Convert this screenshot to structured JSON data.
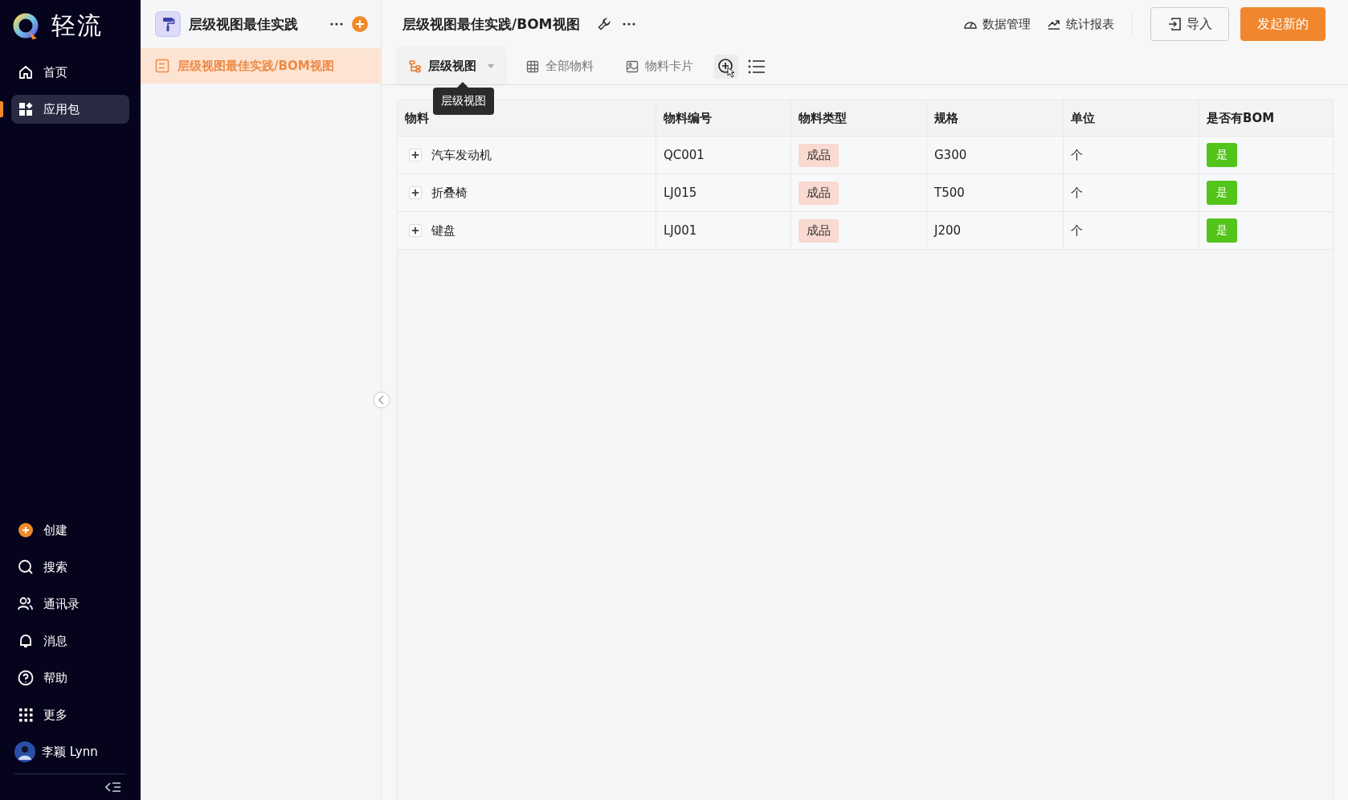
{
  "app": {
    "logo_text": "轻流"
  },
  "nav": [
    {
      "label": "首页",
      "selected": false
    },
    {
      "label": "应用包",
      "selected": true
    }
  ],
  "nav_bottom": [
    {
      "label": "创建"
    },
    {
      "label": "搜索"
    },
    {
      "label": "通讯录"
    },
    {
      "label": "消息"
    },
    {
      "label": "帮助"
    },
    {
      "label": "更多"
    }
  ],
  "user": {
    "name": "李颖 Lynn"
  },
  "project": {
    "title": "层级视图最佳实践",
    "items": [
      {
        "label": "层级视图最佳实践/BOM视图",
        "selected": true
      }
    ]
  },
  "page": {
    "title": "层级视图最佳实践/BOM视图",
    "links": [
      "数据管理",
      "统计报表"
    ],
    "buttons": [
      {
        "label": "导入",
        "primary": false
      },
      {
        "label": "发起新的",
        "primary": true
      }
    ]
  },
  "tabs": [
    {
      "label": "层级视图",
      "selected": true
    },
    {
      "label": "全部物料",
      "selected": false
    },
    {
      "label": "物料卡片",
      "selected": false
    }
  ],
  "tooltip": "层级视图",
  "table": {
    "columns": [
      "物料",
      "物料编号",
      "物料类型",
      "规格",
      "单位",
      "是否有BOM"
    ],
    "rows": [
      {
        "name": "汽车发动机",
        "expanded": false,
        "code": "QC001",
        "type": "成品",
        "spec": "G300",
        "unit": "个",
        "bom": "是"
      },
      {
        "name": "折叠椅",
        "expanded": false,
        "code": "LJ015",
        "type": "成品",
        "spec": "T500",
        "unit": "个",
        "bom": "是"
      },
      {
        "name": "键盘",
        "expanded": false,
        "code": "LJ001",
        "type": "成品",
        "spec": "J200",
        "unit": "个",
        "bom": "是"
      }
    ]
  }
}
